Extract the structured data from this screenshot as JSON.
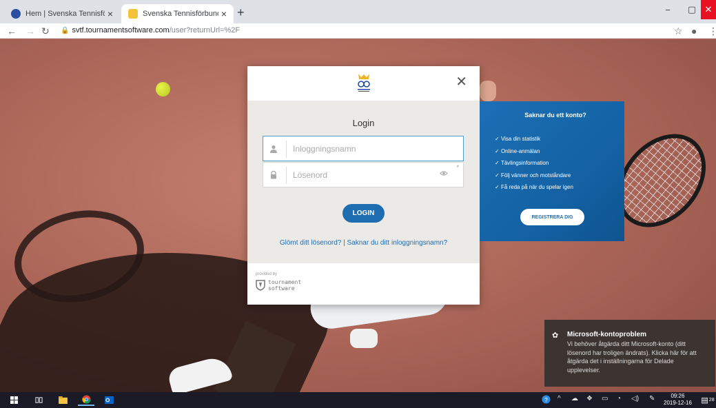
{
  "browser": {
    "tabs": [
      {
        "title": "Hem | Svenska Tennisförbundet",
        "close": "×"
      },
      {
        "title": "Svenska Tennisförbundet",
        "close": "×"
      }
    ],
    "new_tab": "+",
    "url_host": "svtf.tournamentsoftware.com",
    "url_path": "/user?returnUrl=%2F",
    "window_controls": {
      "minimize": "−",
      "maximize": "▢",
      "close": "✕"
    }
  },
  "login": {
    "title": "Login",
    "username_placeholder": "Inloggningsnamn",
    "password_placeholder": "Lösenord",
    "required_mark": "*",
    "button": "LOGIN",
    "forgot_password": "Glömt ditt lösenord?",
    "separator": " | ",
    "forgot_username": "Saknar du ditt inloggningsnamn?",
    "provided_by": "provided by",
    "provider_line1": "tournament",
    "provider_line2": "software"
  },
  "signup": {
    "title": "Saknar du ett konto?",
    "benefits": [
      "Visa din statistik",
      "Online-anmälan",
      "Tävlingsinformation",
      "Följ vänner och motståndare",
      "Få reda på när du spelar igen"
    ],
    "button": "REGISTRERA DIG"
  },
  "notification": {
    "title": "Microsoft-kontoproblem",
    "body": "Vi behöver åtgärda ditt Microsoft-konto (ditt lösenord har troligen ändrats). Klicka här för att åtgärda det i inställningarna för Delade upplevelser."
  },
  "taskbar": {
    "time": "09:26",
    "date": "2019-12-16",
    "notification_count": "28"
  },
  "colors": {
    "accent_blue": "#1f6db1",
    "close_red": "#e81123",
    "toast_bg": "#3b3431"
  }
}
